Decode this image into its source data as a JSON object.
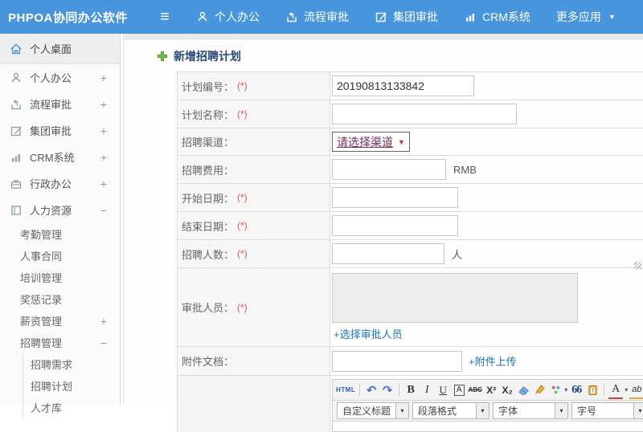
{
  "colors": {
    "header_bg": "#4795dd",
    "link_blue": "#1b75bb",
    "required_red": "#e25555",
    "title_navy": "#26477c",
    "select_text": "#7b2e58",
    "select_caret": "#e02020",
    "plus_green": "#5cb85c",
    "sidebar_bg": "#fbfbfb"
  },
  "header": {
    "logo": "PHPOA协同办公软件",
    "menu_icon": "≡",
    "nav": [
      {
        "label": "个人办公"
      },
      {
        "label": "流程审批"
      },
      {
        "label": "集团审批"
      },
      {
        "label": "CRM系统"
      },
      {
        "label": "更多应用",
        "caret": "▼"
      }
    ]
  },
  "sidebar": {
    "items": [
      {
        "label": "个人桌面",
        "expand": ""
      },
      {
        "label": "个人办公",
        "expand": "+"
      },
      {
        "label": "流程审批",
        "expand": "+"
      },
      {
        "label": "集团审批",
        "expand": "+"
      },
      {
        "label": "CRM系统",
        "expand": "+"
      },
      {
        "label": "行政办公",
        "expand": "+"
      },
      {
        "label": "人力资源",
        "expand": "−"
      }
    ],
    "hr_subitems": [
      {
        "label": "考勤管理",
        "expand": ""
      },
      {
        "label": "人事合同",
        "expand": ""
      },
      {
        "label": "培训管理",
        "expand": ""
      },
      {
        "label": "奖惩记录",
        "expand": ""
      },
      {
        "label": "薪资管理",
        "expand": "+"
      },
      {
        "label": "招聘管理",
        "expand": "−"
      }
    ],
    "recruit_subitems": [
      {
        "label": "招聘需求"
      },
      {
        "label": "招聘计划"
      },
      {
        "label": "人才库"
      }
    ]
  },
  "main": {
    "title": "新增招聘计划",
    "form": {
      "rows": [
        {
          "label": "计划编号：",
          "required": "(*)",
          "value": "20190813133842"
        },
        {
          "label": "计划名称：",
          "required": "(*)",
          "value": ""
        },
        {
          "label": "招聘渠道：",
          "required": "",
          "select_value": "请选择渠道"
        },
        {
          "label": "招聘费用：",
          "required": "",
          "value": "",
          "unit": "RMB"
        },
        {
          "label": "开始日期：",
          "required": "(*)",
          "value": ""
        },
        {
          "label": "结束日期：",
          "required": "(*)",
          "value": ""
        },
        {
          "label": "招聘人数：",
          "required": "(*)",
          "value": "",
          "unit": "人"
        },
        {
          "label": "审批人员：",
          "required": "(*)",
          "textarea_value": "",
          "link": "+选择审批人员"
        },
        {
          "label": "附件文档：",
          "required": "",
          "value": "",
          "link": "+附件上传"
        }
      ]
    }
  },
  "editor": {
    "html_label": "HTML",
    "undo_glyph": "↶",
    "redo_glyph": "↷",
    "bold": "B",
    "italic": "I",
    "underline": "U",
    "boxed_a": "A",
    "strike": "ABC",
    "superscript": "X²",
    "subscript": "X₂",
    "quote": "66",
    "font_color": "A",
    "highlight": "ab",
    "caret": "▾",
    "combos": [
      {
        "label": "自定义标题"
      },
      {
        "label": "段落格式"
      },
      {
        "label": "字体"
      },
      {
        "label": "字号"
      }
    ]
  }
}
